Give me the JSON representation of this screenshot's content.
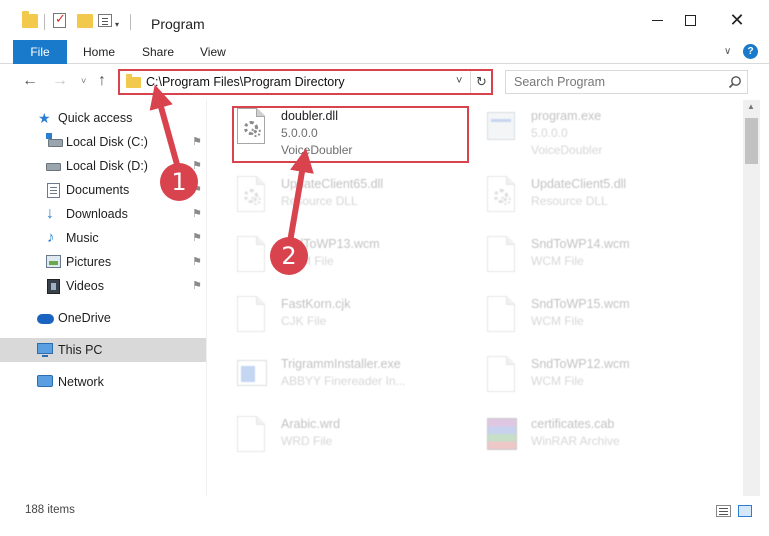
{
  "window": {
    "title": "Program",
    "minimize_icon": "minimize-icon",
    "maximize_icon": "maximize-icon",
    "close_icon": "close-icon"
  },
  "ribbon": {
    "tabs": [
      "File",
      "Home",
      "Share",
      "View"
    ],
    "help_label": "?"
  },
  "nav": {
    "back": "←",
    "forward": "→",
    "recent": "˅",
    "up": "↑"
  },
  "address": {
    "path": "C:\\Program Files\\Program Directory",
    "dropdown": "˅",
    "refresh": "↻"
  },
  "search": {
    "placeholder": "Search Program"
  },
  "sidebar": {
    "items": [
      {
        "label": "Quick access"
      },
      {
        "label": "Local Disk (C:)",
        "pin": "📌"
      },
      {
        "label": "Local Disk (D:)",
        "pin": "📌"
      },
      {
        "label": "Documents",
        "pin": "📌"
      },
      {
        "label": "Downloads",
        "pin": "📌"
      },
      {
        "label": "Music",
        "pin": "📌"
      },
      {
        "label": "Pictures",
        "pin": "📌"
      },
      {
        "label": "Videos",
        "pin": "📌"
      },
      {
        "label": "OneDrive"
      },
      {
        "label": "This PC"
      },
      {
        "label": "Network"
      }
    ]
  },
  "files": [
    {
      "name": "doubler.dll",
      "sub1": "5.0.0.0",
      "sub2": "VoiceDoubler",
      "icon": "dll-gear-icon"
    },
    {
      "name": "program.exe",
      "sub1": "5.0.0.0",
      "sub2": "VoiceDoubler",
      "icon": "exe-icon"
    },
    {
      "name": "UpdateClient65.dll",
      "sub1": "Resource DLL",
      "icon": "dll-gear-icon"
    },
    {
      "name": "UpdateClient5.dll",
      "sub1": "Resource DLL",
      "icon": "dll-gear-icon"
    },
    {
      "name": "SndToWP13.wcm",
      "sub1": "WCM File",
      "icon": "document-icon"
    },
    {
      "name": "SndToWP14.wcm",
      "sub1": "WCM File",
      "icon": "document-icon"
    },
    {
      "name": "FastKorn.cjk",
      "sub1": "CJK File",
      "icon": "document-icon"
    },
    {
      "name": "SndToWP15.wcm",
      "sub1": "WCM File",
      "icon": "document-icon"
    },
    {
      "name": "TrigrammInstaller.exe",
      "sub1": "ABBYY Finereader In...",
      "icon": "installer-icon"
    },
    {
      "name": "SndToWP12.wcm",
      "sub1": "WCM File",
      "icon": "document-icon"
    },
    {
      "name": "Arabic.wrd",
      "sub1": "WRD File",
      "icon": "document-icon"
    },
    {
      "name": "certificates.cab",
      "sub1": "WinRAR Archive",
      "icon": "winrar-icon"
    }
  ],
  "status": {
    "count": "188 items"
  },
  "annotations": {
    "marker1": "1",
    "marker2": "2",
    "color": "#d9434e"
  },
  "colors": {
    "accent": "#1979ca",
    "highlight": "#d9434e"
  }
}
